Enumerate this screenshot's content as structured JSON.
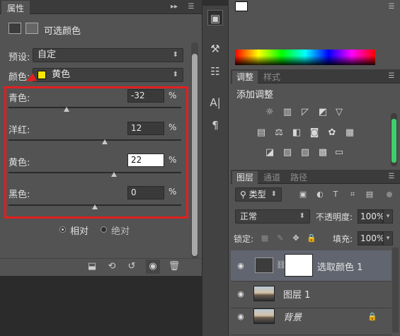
{
  "properties_panel": {
    "tab_label": "属性",
    "menu_glyph": "▸▸",
    "title": "可选颜色",
    "preset_label": "预设:",
    "preset_value": "自定",
    "color_label": "颜色:",
    "color_value": "黄色",
    "color_swatch": "#ffe600",
    "sliders": [
      {
        "label": "青色:",
        "value": "-32",
        "unit": "%",
        "level": -32
      },
      {
        "label": "洋红:",
        "value": "12",
        "unit": "%",
        "level": 12
      },
      {
        "label": "黄色:",
        "value": "22",
        "unit": "%",
        "level": 22
      },
      {
        "label": "黑色:",
        "value": "0",
        "unit": "%",
        "level": 0
      }
    ],
    "method_options": [
      {
        "label": "相对",
        "selected": true
      },
      {
        "label": "绝对",
        "selected": false
      }
    ],
    "highlight_color": "#e02020"
  },
  "adjustments_panel": {
    "tabs": [
      "调整",
      "样式"
    ],
    "title": "添加调整"
  },
  "layers_panel": {
    "tabs": [
      "图层",
      "通道",
      "路径"
    ],
    "filter_label": "类型",
    "blend_mode": "正常",
    "opacity_label": "不透明度:",
    "opacity_value": "100%",
    "lock_label": "锁定:",
    "fill_label": "填充:",
    "fill_value": "100%",
    "layers": [
      {
        "name": "选取颜色 1",
        "type": "adjustment",
        "selected": true
      },
      {
        "name": "图层 1",
        "type": "image",
        "selected": false
      },
      {
        "name": "背景",
        "type": "image",
        "selected": false
      }
    ]
  },
  "color_panel": {
    "spectrum": "hue"
  }
}
